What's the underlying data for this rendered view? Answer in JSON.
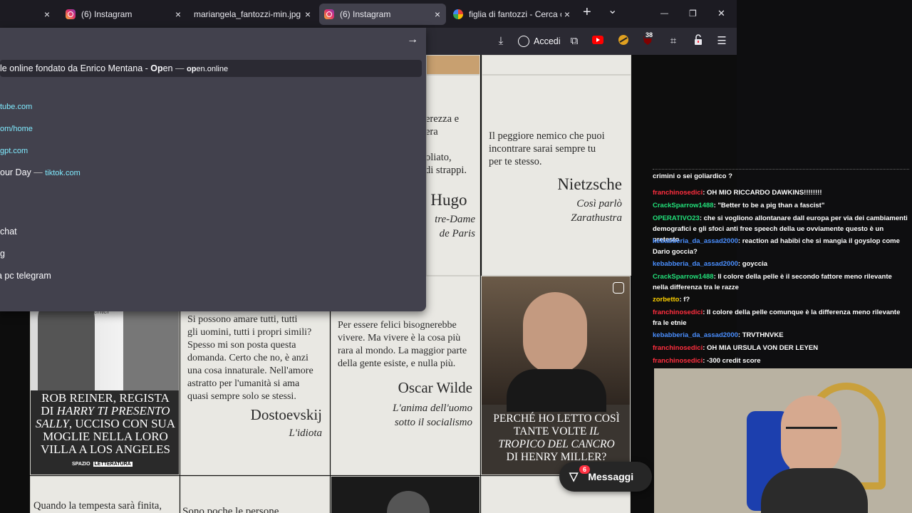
{
  "tabs": [
    {
      "title": "",
      "active": false
    },
    {
      "title": "(6) Instagram",
      "active": false,
      "icon": "instagram-icon"
    },
    {
      "title": "mariangela_fantozzi-min.jpg (im",
      "active": false
    },
    {
      "title": "(6) Instagram",
      "active": true,
      "icon": "instagram-icon"
    },
    {
      "title": "figlia di fantozzi - Cerca con",
      "active": false,
      "icon": "google-icon"
    }
  ],
  "tab_close_glyph": "×",
  "window_controls": {
    "new_tab": "+",
    "list": "⌄",
    "minimize": "—",
    "maximize": "❐",
    "close": "✕"
  },
  "toolbar": {
    "accedi": "Accedi",
    "badge": "38"
  },
  "urlbar": {
    "arrow": "→"
  },
  "suggestions": {
    "top": {
      "text_pre": "le online fondato da Enrico Mentana - ",
      "text_bold": "Op",
      "text_post": "en",
      "sep": " — ",
      "url_bold": "op",
      "url_rest": "en.online"
    },
    "items": [
      {
        "url": "tube.com"
      },
      {
        "url": "om/home"
      },
      {
        "url": "gpt.com"
      },
      {
        "text": "our Day",
        "sep": " — ",
        "url": "tiktok.com"
      }
    ],
    "history": [
      "chat",
      "g",
      "a pc telegram"
    ]
  },
  "posts": [
    {
      "quote": "erezza e\nera\n\noliato,\ndi strappi.",
      "author": "r Hugo",
      "work": "tre-Dame\nde Paris"
    },
    {
      "quote": "Il peggiore nemico che puoi\nincontrare sarai sempre tu\nper te stesso.",
      "author": "Nietzsche",
      "work": "Così parlò\nZarathustra"
    },
    {
      "caption": "ROB REINER, REGISTA\nDI HARRY TI PRESENTO\nSALLY, UCCISO CON SUA\nMOGLIE NELLA LORO\nVILLA A LOS ANGELES",
      "brand_a": "SPAZIO",
      "brand_b": "LETTERATURA",
      "bg_text": "enter"
    },
    {
      "quote": "Si possono amare tutti, tutti\ngli uomini, tutti i propri simili?\nSpesso mi son posta questa\ndomanda. Certo che no, è anzi\nuna cosa innaturale. Nell'amore\nastratto per l'umanità si ama\nquasi sempre solo se stessi.",
      "author": "Dostoevskij",
      "work": "L'idiota"
    },
    {
      "quote": "Per essere felici bisognerebbe\nvivere. Ma vivere è la cosa più\nrara al mondo. La maggior parte\ndella gente esiste, e nulla più.",
      "author": "Oscar Wilde",
      "work": "L'anima dell'uomo\nsotto il socialismo"
    },
    {
      "caption": "PERCHÉ HO LETTO COSÌ\nTANTE VOLTE IL\nTROPICO DEL CANCRO\nDI HENRY MILLER?"
    },
    {
      "quote": "Quando la tempesta sarà finita,"
    },
    {
      "quote": "Sono poche le persone"
    }
  ],
  "messaggi": {
    "label": "Messaggi",
    "count": "6"
  },
  "chat": {
    "colors": {
      "red": "#ff2e3e",
      "green": "#22e07a",
      "blue": "#4a8fff",
      "yellow": "#ffd200"
    },
    "messages": [
      {
        "user": "",
        "color": "red",
        "text": "crimini o sei goliardico ?"
      },
      {
        "user": "franchinosedici",
        "color": "red",
        "text": ": OH MIO RICCARDO DAWKINS!!!!!!!!"
      },
      {
        "user": "CrackSparrow1488",
        "color": "green",
        "text": ": \"Better to be a pig than a fascist\""
      },
      {
        "user": "OPERATIVO23",
        "color": "green",
        "text": ": che si vogliono allontanare dall europa per via dei cambiamenti demografici e gli sfoci anti free speech della ue ovviamente questo è un pretesto"
      },
      {
        "user": "kebabberia_da_assad2000",
        "color": "blue",
        "text": ": reaction ad habibi che si mangia il goyslop come Dario goccia?"
      },
      {
        "user": "kebabberia_da_assad2000",
        "color": "blue",
        "text": ": goyccia"
      },
      {
        "user": "CrackSparrow1488",
        "color": "green",
        "text": ": Il colore della pelle è il secondo fattore meno rilevante nella differenza tra le razze"
      },
      {
        "user": "zorbetto",
        "color": "yellow",
        "text": ": f?"
      },
      {
        "user": "franchinosedici",
        "color": "red",
        "text": ": Il colore della pelle comunque è la differenza meno rilevante fra le etnie"
      },
      {
        "user": "kebabberia_da_assad2000",
        "color": "blue",
        "text": ": TRVTHNVKE"
      },
      {
        "user": "franchinosedici",
        "color": "red",
        "text": ": OH MIA URSULA VON DER LEYEN"
      },
      {
        "user": "franchinosedici",
        "color": "red",
        "text": ": -300 credit score"
      }
    ]
  }
}
